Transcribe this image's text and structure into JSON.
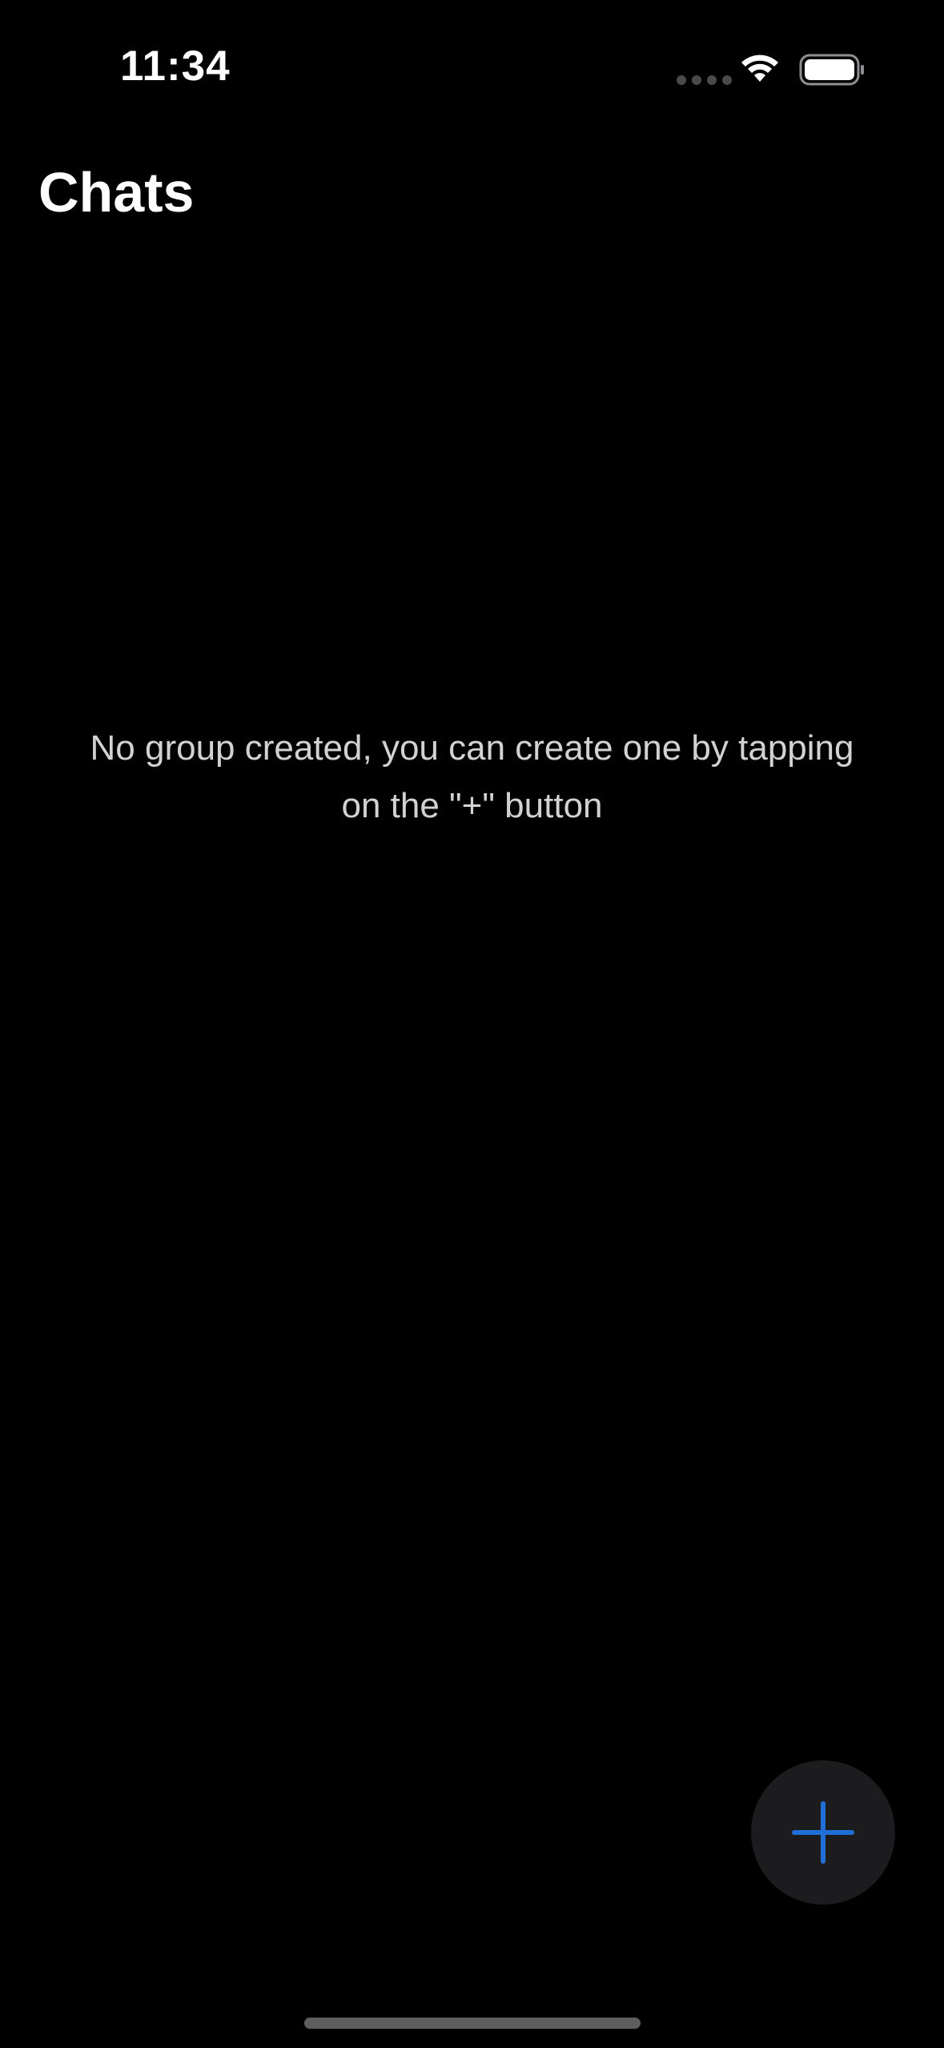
{
  "status_bar": {
    "time": "11:34"
  },
  "header": {
    "title": "Chats"
  },
  "empty_state": {
    "message": "No group created, you can create one by tapping on the \"+\" button"
  },
  "fab": {
    "icon": "plus-icon",
    "accent_color": "#1f6fd6"
  },
  "colors": {
    "background": "#000000",
    "fab_background": "#1c1c1e",
    "message_text": "#d2d2d2"
  }
}
